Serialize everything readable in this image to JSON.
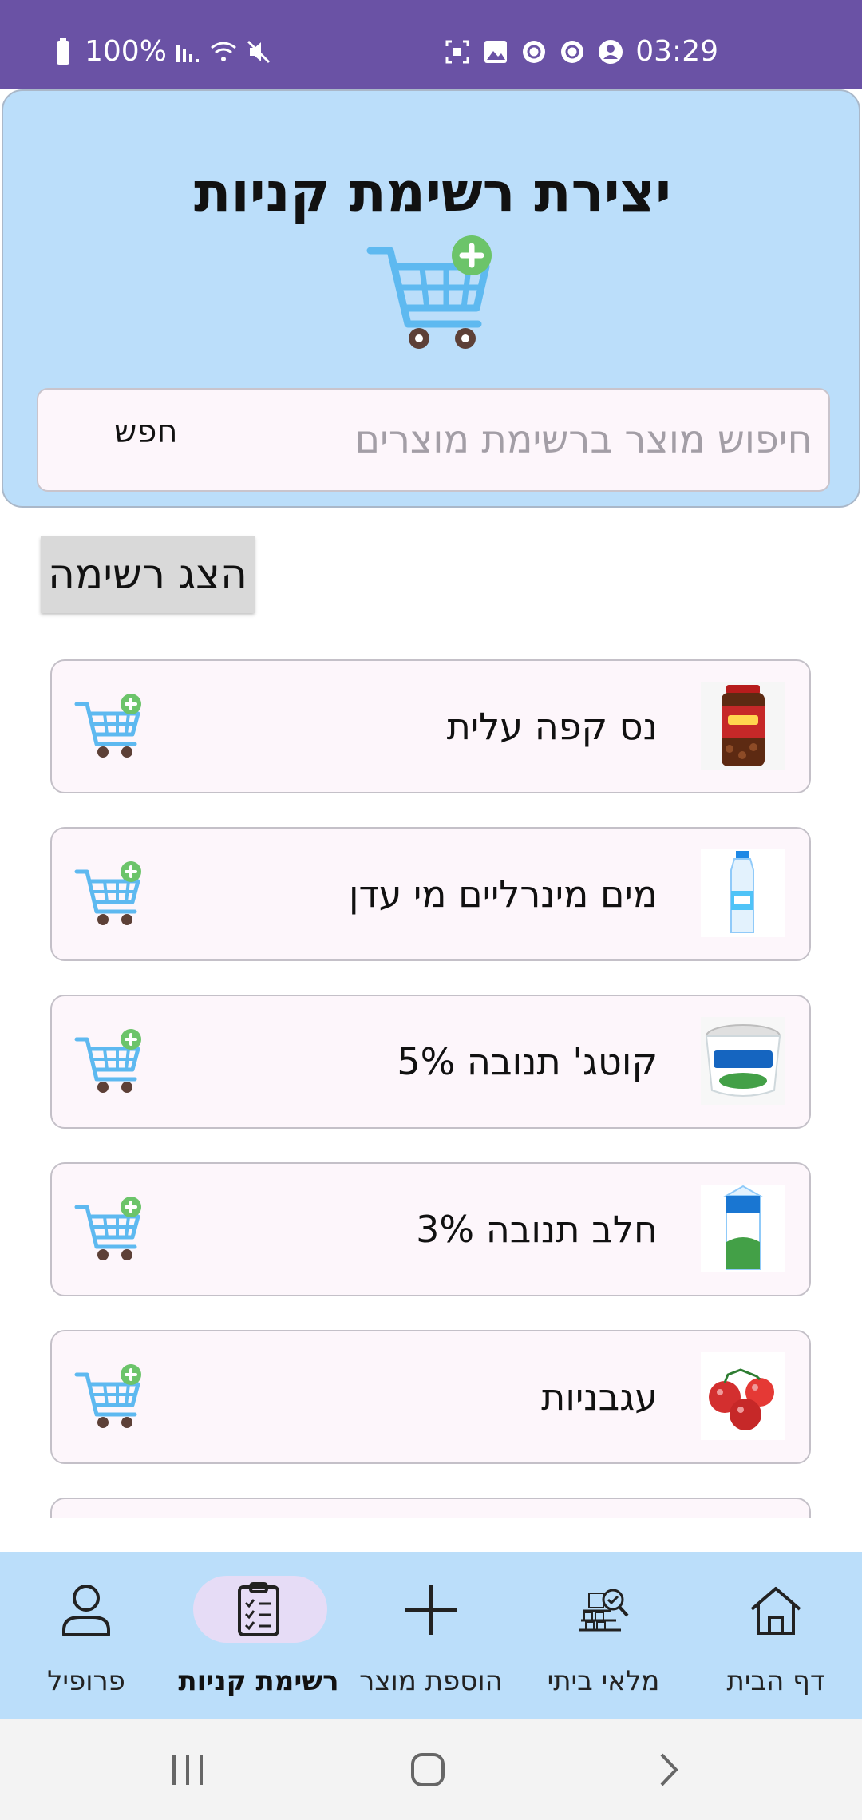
{
  "status_bar": {
    "battery": "100%",
    "time": "03:29"
  },
  "header": {
    "title": "יצירת רשימת קניות",
    "icon": "shopping-cart-add-icon"
  },
  "search": {
    "placeholder": "חיפוש מוצר ברשימת מוצרים",
    "button_label": "חפש"
  },
  "show_list_button": "הצג רשימה",
  "products": [
    {
      "name": "נס קפה עלית",
      "image": "coffee-jar"
    },
    {
      "name": "מים מינרליים מי עדן",
      "image": "water-bottle"
    },
    {
      "name": "קוטג' תנובה 5%",
      "image": "cottage-cheese"
    },
    {
      "name": "חלב תנובה 3%",
      "image": "milk-carton"
    },
    {
      "name": "עגבניות",
      "image": "tomatoes"
    }
  ],
  "bottom_nav": [
    {
      "label": "פרופיל",
      "icon": "person-icon",
      "active": false
    },
    {
      "label": "רשימת קניות",
      "icon": "clipboard-list-icon",
      "active": true
    },
    {
      "label": "הוספת מוצר",
      "icon": "plus-icon",
      "active": false
    },
    {
      "label": "מלאי ביתי",
      "icon": "inventory-icon",
      "active": false
    },
    {
      "label": "דף הבית",
      "icon": "home-icon",
      "active": false
    }
  ],
  "colors": {
    "status_bar": "#6a52a5",
    "header_bg": "#bbdefa",
    "card_bg": "#fdf6fb",
    "active_pill": "#e6dcf6",
    "cart_blue": "#5eb9f0",
    "plus_green": "#6cc46a"
  }
}
